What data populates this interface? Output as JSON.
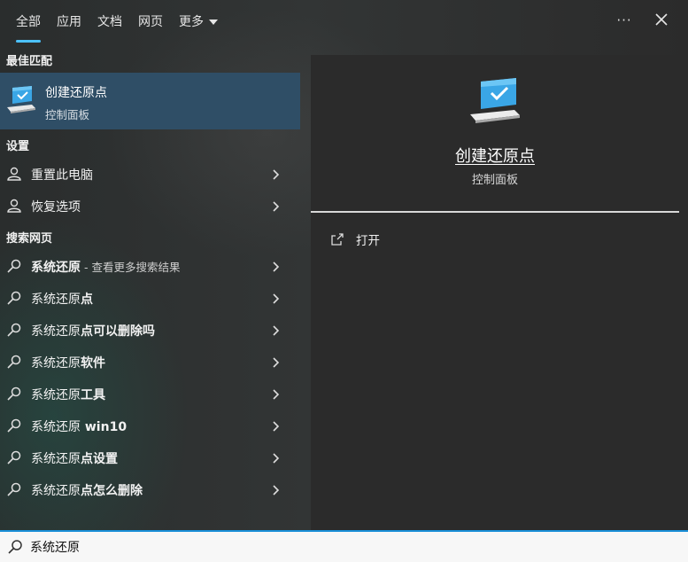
{
  "tabs": [
    {
      "label": "全部",
      "active": true
    },
    {
      "label": "应用"
    },
    {
      "label": "文档"
    },
    {
      "label": "网页"
    },
    {
      "label": "更多"
    }
  ],
  "topbar": {
    "more_icon": "ellipsis-icon",
    "close_icon": "close-icon"
  },
  "best_match": {
    "section": "最佳匹配",
    "title": "创建还原点",
    "subtitle": "控制面板",
    "icon": "computer-check-icon"
  },
  "settings": {
    "section": "设置",
    "items": [
      {
        "label": "重置此电脑",
        "icon": "reset-pc-icon"
      },
      {
        "label": "恢复选项",
        "icon": "recovery-icon"
      }
    ]
  },
  "web": {
    "section": "搜索网页",
    "items": [
      {
        "main": "系统还原",
        "suffix": " - 查看更多搜索结果"
      },
      {
        "main": "系统还原",
        "bold": "点"
      },
      {
        "main": "系统还原",
        "bold": "点可以删除吗"
      },
      {
        "main": "系统还原",
        "bold": "软件"
      },
      {
        "main": "系统还原",
        "bold": "工具"
      },
      {
        "main": "系统还原",
        "bold": " win10"
      },
      {
        "main": "系统还原",
        "bold": "点设置"
      },
      {
        "main": "系统还原",
        "bold": "点怎么删除"
      }
    ]
  },
  "preview": {
    "title": "创建还原点",
    "subtitle": "控制面板",
    "action": "打开",
    "action_icon": "open-external-icon"
  },
  "search": {
    "value": "系统还原",
    "icon": "search-icon"
  },
  "colors": {
    "accent": "#4cc2ff",
    "selected_bg": "#2f4e66",
    "search_border": "#1a8fd8"
  }
}
